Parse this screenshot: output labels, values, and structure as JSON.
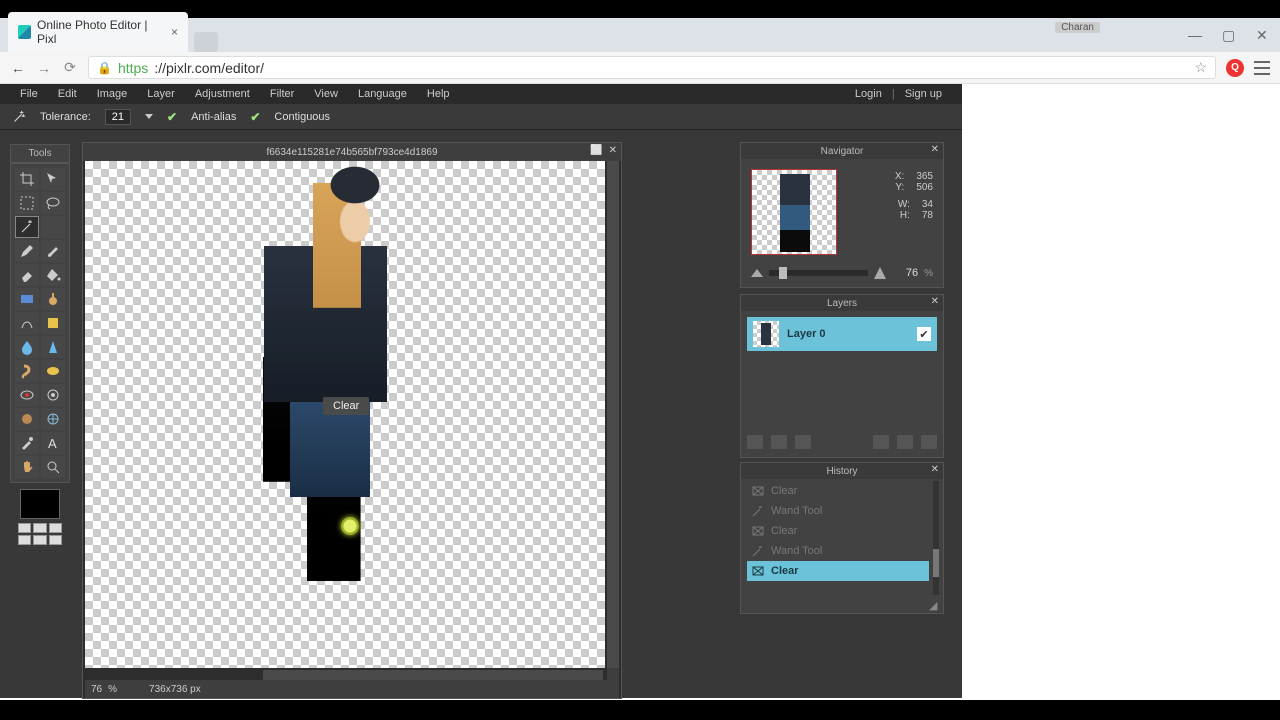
{
  "browser": {
    "tab_title": "Online Photo Editor | Pixl",
    "url_scheme": "https",
    "url_rest": "://pixlr.com/editor/",
    "user_badge": "Charan"
  },
  "menu": {
    "file": "File",
    "edit": "Edit",
    "image": "Image",
    "layer": "Layer",
    "adjustment": "Adjustment",
    "filter": "Filter",
    "view": "View",
    "language": "Language",
    "help": "Help",
    "login": "Login",
    "signup": "Sign up"
  },
  "options": {
    "tolerance_label": "Tolerance:",
    "tolerance_value": "21",
    "antialias": "Anti-alias",
    "contiguous": "Contiguous"
  },
  "tools_title": "Tools",
  "document": {
    "title": "f6634e115281e74b565bf793ce4d1869",
    "tooltip": "Clear",
    "zoom": "76",
    "zoom_unit": "%",
    "dimensions": "736x736 px"
  },
  "navigator": {
    "title": "Navigator",
    "x_label": "X:",
    "x": "365",
    "y_label": "Y:",
    "y": "506",
    "w_label": "W:",
    "w": "34",
    "h_label": "H:",
    "h": "78",
    "zoom": "76",
    "zoom_unit": "%"
  },
  "layers": {
    "title": "Layers",
    "items": [
      {
        "name": "Layer 0",
        "visible": true
      }
    ]
  },
  "history": {
    "title": "History",
    "items": [
      {
        "label": "Clear",
        "kind": "clear",
        "state": "dim"
      },
      {
        "label": "Wand Tool",
        "kind": "wand",
        "state": "dim"
      },
      {
        "label": "Clear",
        "kind": "clear",
        "state": "dim"
      },
      {
        "label": "Wand Tool",
        "kind": "wand",
        "state": "dim"
      },
      {
        "label": "Clear",
        "kind": "clear",
        "state": "active"
      }
    ]
  }
}
